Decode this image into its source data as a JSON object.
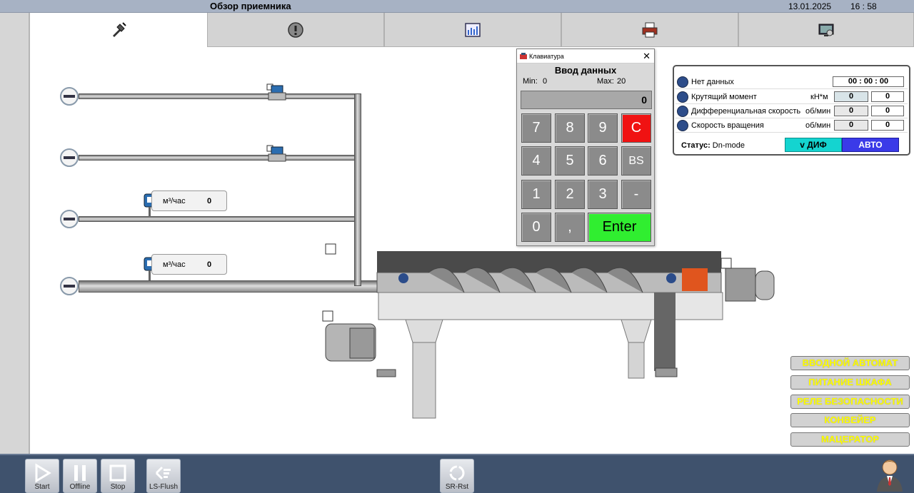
{
  "header": {
    "title": "Обзор приемника",
    "date": "13.01.2025",
    "time": "16 : 58"
  },
  "tabs": [
    {
      "icon": "drill-icon"
    },
    {
      "icon": "warning-icon"
    },
    {
      "icon": "chart-icon"
    },
    {
      "icon": "printer-icon"
    },
    {
      "icon": "monitor-settings-icon"
    }
  ],
  "keypad": {
    "window_title": "Клавиатура",
    "heading": "Ввод данных",
    "min_label": "Min:",
    "min_value": "0",
    "max_label": "Max:",
    "max_value": "20",
    "display": "0",
    "keys": [
      "7",
      "8",
      "9",
      "C",
      "4",
      "5",
      "6",
      "BS",
      "1",
      "2",
      "3",
      "-",
      "0",
      ",",
      "Enter"
    ]
  },
  "flow_meters": [
    {
      "unit": "м³/час",
      "value": "0"
    },
    {
      "unit": "м³/час",
      "value": "0"
    }
  ],
  "info_panel": {
    "no_data_label": "Нет данных",
    "no_data_time": "00 : 00 : 00",
    "rows": [
      {
        "label": "Крутящий момент",
        "unit": "кН*м",
        "value1": "0",
        "value2": "0"
      },
      {
        "label": "Дифференциальная скорость",
        "unit": "об/мин",
        "value1": "0",
        "value2": "0"
      },
      {
        "label": "Скорость вращения",
        "unit": "об/мин",
        "value1": "0",
        "value2": "0"
      }
    ],
    "status_label": "Статус:",
    "status_value": "Dn-mode",
    "btn_dif": "v ДИФ",
    "btn_avto": "АВТО",
    "colors": {
      "dif": "#14d4d0",
      "avto": "#3a3ae8"
    }
  },
  "right_buttons": [
    "ВВОДНОЙ АВТОМАТ",
    "ПИТАНИЕ ШКАФА",
    "РЕЛЕ БЕЗОПАСНОСТИ",
    "КОНВЕЙЕР",
    "МАЦЕРАТОР"
  ],
  "bottom": {
    "buttons": [
      {
        "label": "Start",
        "icon": "play-icon"
      },
      {
        "label": "Offline",
        "icon": "pause-icon"
      },
      {
        "label": "Stop",
        "icon": "stop-icon"
      },
      {
        "label": "LS-Flush",
        "icon": "flush-icon"
      },
      {
        "label": "SR-Rst",
        "icon": "reset-icon"
      }
    ]
  }
}
